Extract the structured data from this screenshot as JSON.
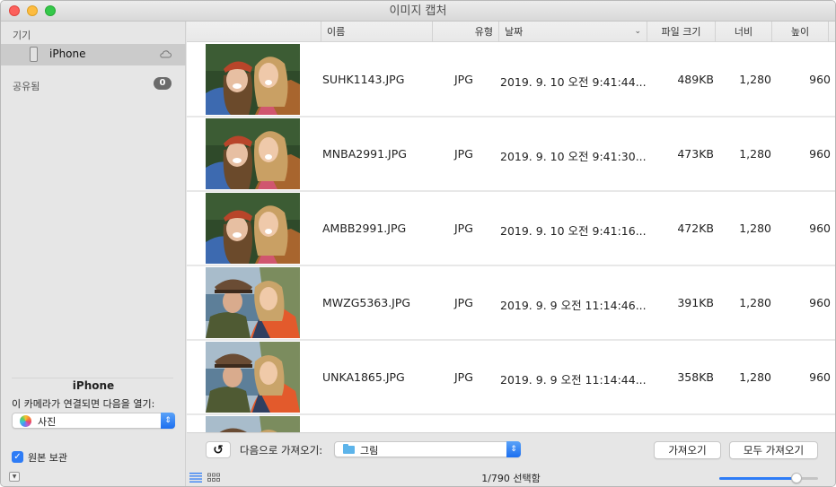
{
  "window": {
    "title": "이미지 캡처"
  },
  "sidebar": {
    "devices_header": "기기",
    "device": {
      "label": "iPhone",
      "icon": "phone-icon",
      "status_icon": "cloud-icon"
    },
    "shared_header": "공유됨",
    "shared_count": "0",
    "device_name": "iPhone",
    "open_label": "이 카메라가 연결되면 다음을 열기:",
    "open_app": {
      "value": "사진",
      "icon": "photos-icon"
    },
    "keep_originals": {
      "label": "원본 보관",
      "checked": true
    }
  },
  "table": {
    "columns": {
      "name": "이름",
      "type": "유형",
      "date": "날짜",
      "size": "파일 크기",
      "width": "너비",
      "height": "높이"
    },
    "sort_indicator": "⌄",
    "rows": [
      {
        "name": "SUHK1143.JPG",
        "type": "JPG",
        "date": "2019. 9. 10 오전 9:41:44...",
        "size": "489KB",
        "width": "1,280",
        "height": "960",
        "thumb": "selfie-red-beret"
      },
      {
        "name": "MNBA2991.JPG",
        "type": "JPG",
        "date": "2019. 9. 10 오전 9:41:30...",
        "size": "473KB",
        "width": "1,280",
        "height": "960",
        "thumb": "selfie-red-beret"
      },
      {
        "name": "AMBB2991.JPG",
        "type": "JPG",
        "date": "2019. 9. 10 오전 9:41:16...",
        "size": "472KB",
        "width": "1,280",
        "height": "960",
        "thumb": "selfie-red-beret"
      },
      {
        "name": "MWZG5363.JPG",
        "type": "JPG",
        "date": "2019. 9. 9 오전 11:14:46...",
        "size": "391KB",
        "width": "1,280",
        "height": "960",
        "thumb": "selfie-coast-hat"
      },
      {
        "name": "UNKA1865.JPG",
        "type": "JPG",
        "date": "2019. 9. 9 오전 11:14:44...",
        "size": "358KB",
        "width": "1,280",
        "height": "960",
        "thumb": "selfie-coast-hat"
      },
      {
        "name": "",
        "type": "",
        "date": "",
        "size": "",
        "width": "",
        "height": "",
        "thumb": "selfie-coast-hat"
      }
    ]
  },
  "footer": {
    "rotate_glyph": "↺",
    "import_to_label": "다음으로 가져오기:",
    "destination": {
      "value": "그림",
      "icon": "folder-icon"
    },
    "import_button": "가져오기",
    "import_all_button": "모두 가져오기",
    "status": "1/790 선택함",
    "thumbnail_size_percent": 78
  },
  "colors": {
    "accent": "#2e7cf6",
    "sidebar_bg": "#e6e6e6",
    "selected_row_bg": "#cbcbcb"
  }
}
